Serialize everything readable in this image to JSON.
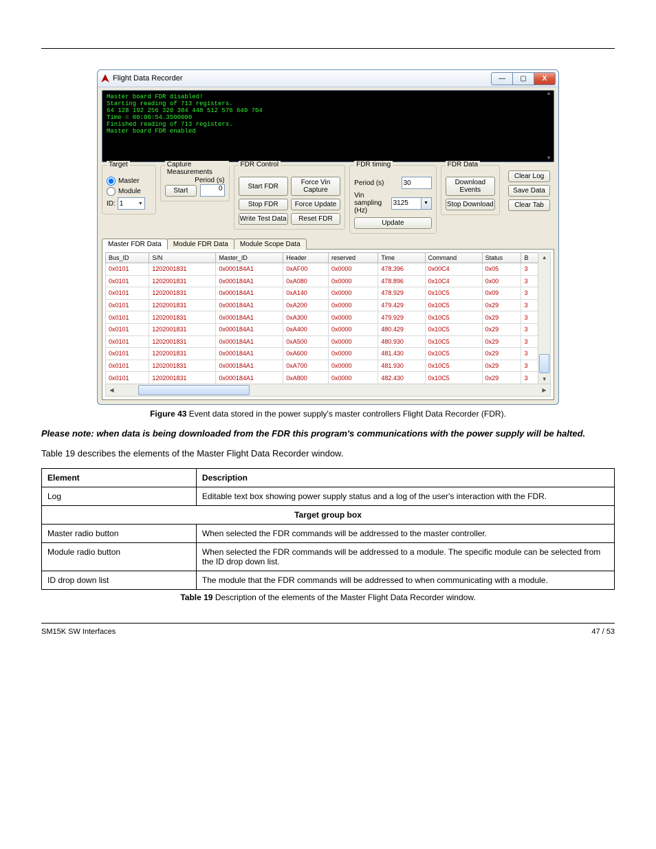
{
  "window": {
    "title": "Flight Data Recorder",
    "console": "Master board FDR disabled!\nStarting reading of 713 registers.\n64 128 192 256 320 384 448 512 576 640 704\nTime = 00:00:54.3500000\nFinished reading of 713 registers.\nMaster board FDR enabled"
  },
  "target": {
    "legend": "Target",
    "radioMaster": "Master",
    "radioModule": "Module",
    "idLabel": "ID:",
    "idValue": "1"
  },
  "capture": {
    "legend": "Capture Measurements",
    "periodLabel": "Period (s)",
    "periodValue": "0",
    "startBtn": "Start"
  },
  "fdrControl": {
    "legend": "FDR Control",
    "startFdr": "Start FDR",
    "forceVin": "Force Vin Capture",
    "stopFdr": "Stop FDR",
    "forceUpdate": "Force Update",
    "writeTest": "Write Test Data",
    "resetFdr": "Reset FDR"
  },
  "fdrTiming": {
    "legend": "FDR timing",
    "periodLabel": "Period (s)",
    "periodValue": "30",
    "vinLabel": "Vin sampling (Hz)",
    "vinValue": "3125",
    "updateBtn": "Update"
  },
  "fdrData": {
    "legend": "FDR Data",
    "downloadEvents": "Download Events",
    "stopDownload": "Stop Download"
  },
  "sideButtons": {
    "clearLog": "Clear Log",
    "saveData": "Save Data",
    "clearTab": "Clear Tab"
  },
  "tabs": {
    "master": "Master FDR Data",
    "moduleFdr": "Module FDR Data",
    "moduleScope": "Module Scope Data"
  },
  "grid": {
    "cols": [
      "Bus_ID",
      "S/N",
      "Master_ID",
      "Header",
      "reserved",
      "Time",
      "Command",
      "Status",
      "B"
    ],
    "rows": [
      [
        "0x0101",
        "1202001831",
        "0x000184A1",
        "0xAF00",
        "0x0000",
        "478.396",
        "0x00C4",
        "0x05",
        "3"
      ],
      [
        "0x0101",
        "1202001831",
        "0x000184A1",
        "0xA080",
        "0x0000",
        "478.896",
        "0x10C4",
        "0x00",
        "3"
      ],
      [
        "0x0101",
        "1202001831",
        "0x000184A1",
        "0xA140",
        "0x0000",
        "478.929",
        "0x10C5",
        "0x09",
        "3"
      ],
      [
        "0x0101",
        "1202001831",
        "0x000184A1",
        "0xA200",
        "0x0000",
        "479.429",
        "0x10C5",
        "0x29",
        "3"
      ],
      [
        "0x0101",
        "1202001831",
        "0x000184A1",
        "0xA300",
        "0x0000",
        "479.929",
        "0x10C5",
        "0x29",
        "3"
      ],
      [
        "0x0101",
        "1202001831",
        "0x000184A1",
        "0xA400",
        "0x0000",
        "480.429",
        "0x10C5",
        "0x29",
        "3"
      ],
      [
        "0x0101",
        "1202001831",
        "0x000184A1",
        "0xA500",
        "0x0000",
        "480.930",
        "0x10C5",
        "0x29",
        "3"
      ],
      [
        "0x0101",
        "1202001831",
        "0x000184A1",
        "0xA600",
        "0x0000",
        "481.430",
        "0x10C5",
        "0x29",
        "3"
      ],
      [
        "0x0101",
        "1202001831",
        "0x000184A1",
        "0xA700",
        "0x0000",
        "481.930",
        "0x10C5",
        "0x29",
        "3"
      ],
      [
        "0x0101",
        "1202001831",
        "0x000184A1",
        "0xA800",
        "0x0000",
        "482.430",
        "0x10C5",
        "0x29",
        "3"
      ]
    ]
  },
  "caption": {
    "figLabel": "Figure 43",
    "figText": "  Event data stored in the power supply's master controllers Flight Data Recorder (FDR)."
  },
  "paras": {
    "p1": "Please note: when data is being downloaded from the FDR this program's communications with the power supply will be halted.",
    "p2": "Table 19 describes the elements of the Master Flight Data Recorder window."
  },
  "elements": {
    "header": [
      "Element",
      "Description"
    ],
    "rows": [
      {
        "el": "Log",
        "desc": "Editable text box showing power supply status and a log of the user's interaction with the FDR."
      },
      {
        "sectionTitle": "Target group box"
      },
      {
        "el": "Master radio button",
        "desc": "When selected the FDR commands will be addressed to the master controller."
      },
      {
        "el": "Module radio button",
        "desc": "When selected the FDR commands will be addressed to a module. The specific module can be selected from the ID drop down list."
      },
      {
        "el": "ID drop down list",
        "desc": "The module that the FDR commands will be addressed to when communicating with a module."
      }
    ]
  },
  "tableCaption": {
    "label": "Table 19 ",
    "text": " Description of the elements of the Master Flight Data Recorder window."
  },
  "footer": {
    "left": "SM15K SW Interfaces",
    "right": "47 / 53"
  }
}
